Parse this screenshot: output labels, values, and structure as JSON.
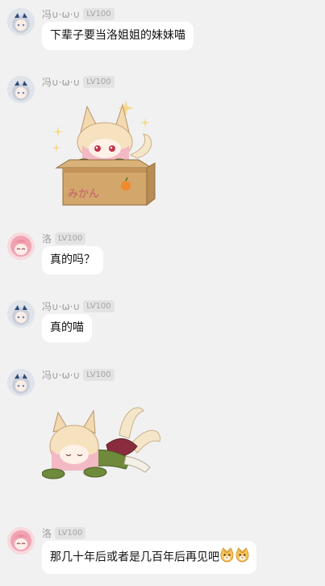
{
  "messages": [
    {
      "sender": "冯∪·ω·∪",
      "level": "LV100",
      "text": "下辈子要当洛姐姐的妹妹喵"
    },
    {
      "sender": "冯∪·ω·∪",
      "level": "LV100",
      "sticker": "fox-girl-in-box-sticker",
      "box_text": "みかん"
    },
    {
      "sender": "洛",
      "level": "LV100",
      "text": "真的吗？"
    },
    {
      "sender": "冯∪·ω·∪",
      "level": "LV100",
      "text": "真的喵"
    },
    {
      "sender": "冯∪·ω·∪",
      "level": "LV100",
      "sticker": "fox-girl-lying-sticker"
    },
    {
      "sender": "洛",
      "level": "LV100",
      "text": "那几十年后或者是几百年后再见吧",
      "emojis": [
        "cat-face-emoji",
        "cat-face-emoji"
      ]
    }
  ],
  "colors": {
    "background": "#f1f1f1",
    "bubble": "#ffffff",
    "nickname": "#9a9a9a",
    "level_badge_bg": "#e3e3e3"
  }
}
